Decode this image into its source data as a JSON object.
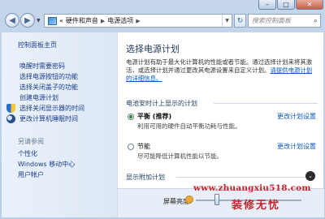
{
  "window": {
    "controls": {
      "minimize": "–",
      "maximize": "□",
      "close": "✕"
    }
  },
  "nav": {
    "back_glyph": "◀",
    "forward_glyph": "▶",
    "breadcrumb": [
      "硬件和声音",
      "电源选项"
    ],
    "crumb_sep": "▶",
    "prefix": "«",
    "search_placeholder": "搜索控制面板",
    "refresh_glyph": "↻",
    "search_icon": "search-icon"
  },
  "sidebar": {
    "home": "控制面板主页",
    "links": [
      {
        "label": "唤醒时需要密码",
        "icon": ""
      },
      {
        "label": "选择电源按钮的功能",
        "icon": ""
      },
      {
        "label": "选择关闭盖子的功能",
        "icon": ""
      },
      {
        "label": "创建电源计划",
        "icon": ""
      },
      {
        "label": "选择关闭显示器的时间",
        "icon": "shield-icon"
      },
      {
        "label": "更改计算机睡眠时间",
        "icon": "moon-icon"
      }
    ],
    "see_also": "另请参阅",
    "see_also_links": [
      "个性化",
      "Windows 移动中心",
      "用户帐户"
    ]
  },
  "main": {
    "title": "选择电源计划",
    "description": "电源计划有助于最大化计算机的性能或者节能。通过选择计划来将其激活，或选择计划并通过更改其电源设置来自定义计划。",
    "more_link": "请提供电源计划的详细信息。",
    "battery_section": "电池安时计上显示的计划",
    "plans": [
      {
        "name": "平衡 (推荐)",
        "desc": "利用可用的硬件自动平衡功耗与性能。",
        "selected": true,
        "change": "更改计划设置"
      },
      {
        "name": "节能",
        "desc": "尽可能降低计算机性能以节能。",
        "selected": false,
        "change": "更改计划设置"
      }
    ],
    "additional_plans": "显示附加计划",
    "brightness_label": "屏幕亮度:",
    "brightness_level": 0.2
  },
  "watermark": {
    "url": "www.zhuangxiu518.com",
    "text": "装修无忧"
  }
}
